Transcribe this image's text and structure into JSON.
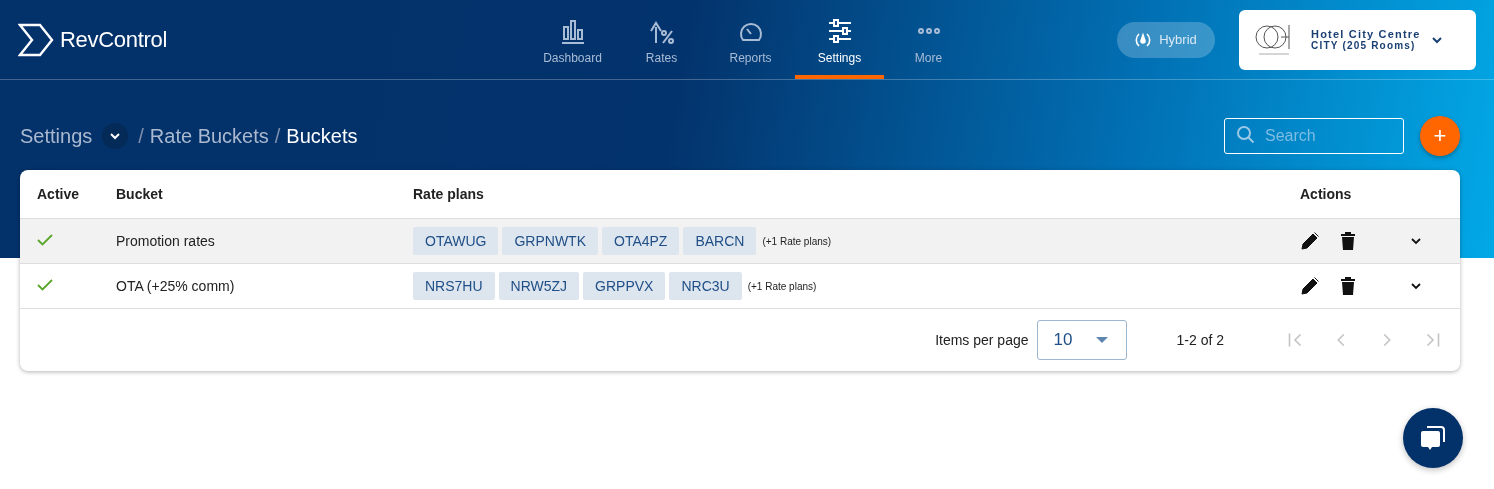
{
  "brand": {
    "name": "RevControl"
  },
  "nav": [
    {
      "kind": "dashboard",
      "label": "Dashboard",
      "selected": false
    },
    {
      "kind": "rates",
      "label": "Rates",
      "selected": false
    },
    {
      "kind": "reports",
      "label": "Reports",
      "selected": false
    },
    {
      "kind": "settings",
      "label": "Settings",
      "selected": true
    },
    {
      "kind": "more",
      "label": "More",
      "selected": false
    }
  ],
  "mode_button": {
    "label": "Hybrid"
  },
  "hotel": {
    "name": "Hotel City Centre",
    "detail": "CITY (205 Rooms)"
  },
  "breadcrumbs": [
    {
      "label": "Settings",
      "current": false,
      "dropdown": true
    },
    {
      "separator": "/",
      "label": "Rate Buckets",
      "current": false
    },
    {
      "separator": "/",
      "label": "Buckets",
      "current": true
    }
  ],
  "search": {
    "placeholder": "Search"
  },
  "add_button": {
    "label": "+"
  },
  "table": {
    "columns": [
      "Active",
      "Bucket",
      "Rate plans",
      "Actions"
    ],
    "rows": [
      {
        "active": true,
        "highlighted": true,
        "bucket": "Promotion rates",
        "rate_plans": [
          "OTAWUG",
          "GRPNWTK",
          "OTA4PZ",
          "BARCN"
        ],
        "more": "(+1 Rate plans)"
      },
      {
        "active": true,
        "highlighted": false,
        "bucket": "OTA (+25% comm)",
        "rate_plans": [
          "NRS7HU",
          "NRW5ZJ",
          "GRPPVX",
          "NRC3U"
        ],
        "more": "(+1 Rate plans)"
      }
    ]
  },
  "pagination": {
    "items_per_page_label": "Items per page",
    "page_size": "10",
    "range": "1-2 of 2",
    "buttons": [
      {
        "kind": "first",
        "disabled": true
      },
      {
        "kind": "prev",
        "disabled": true
      },
      {
        "kind": "next",
        "disabled": true
      },
      {
        "kind": "last",
        "disabled": true
      }
    ]
  }
}
